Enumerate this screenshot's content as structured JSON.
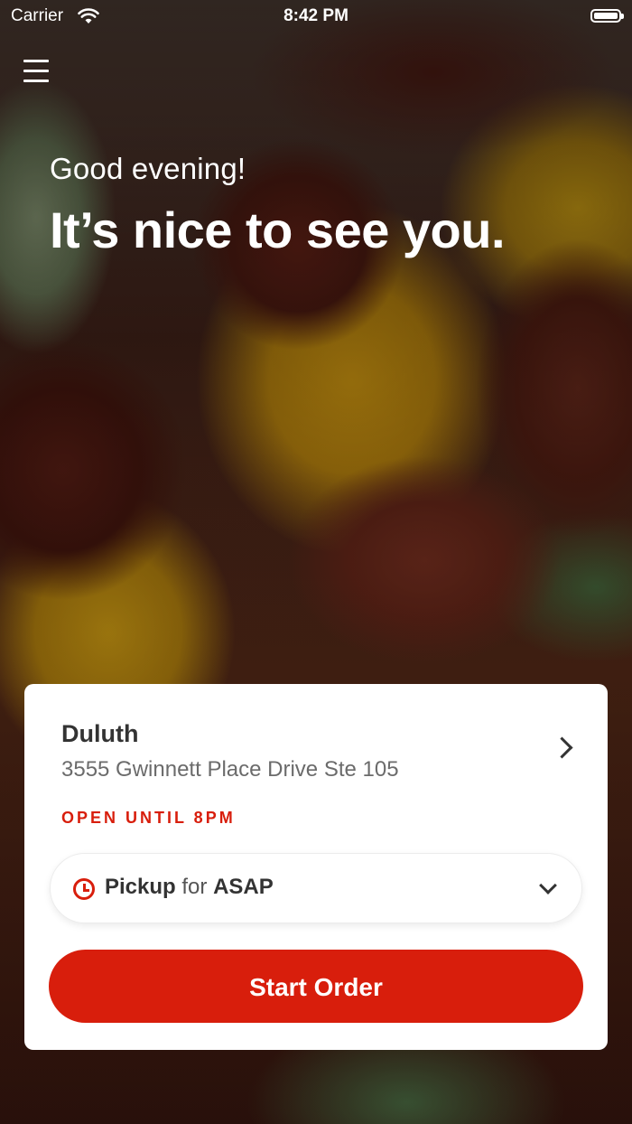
{
  "status_bar": {
    "carrier": "Carrier",
    "time": "8:42 PM"
  },
  "icons": {
    "menu": "hamburger-menu-icon",
    "wifi": "wifi-icon",
    "battery": "battery-icon",
    "chevron_right": "chevron-right-icon",
    "clock": "clock-icon",
    "chevron_down": "chevron-down-icon"
  },
  "greeting": {
    "subtitle": "Good evening!",
    "title": "It’s nice to see you."
  },
  "location": {
    "name": "Duluth",
    "address": "3555 Gwinnett Place Drive Ste 105",
    "hours": "OPEN UNTIL 8PM"
  },
  "order_mode": {
    "method": "Pickup",
    "connector": "for",
    "time": "ASAP"
  },
  "actions": {
    "start_order": "Start Order"
  },
  "colors": {
    "accent": "#d81e0c",
    "card_background": "#ffffff",
    "text_primary": "#333333",
    "text_secondary": "#6b6b6b"
  }
}
